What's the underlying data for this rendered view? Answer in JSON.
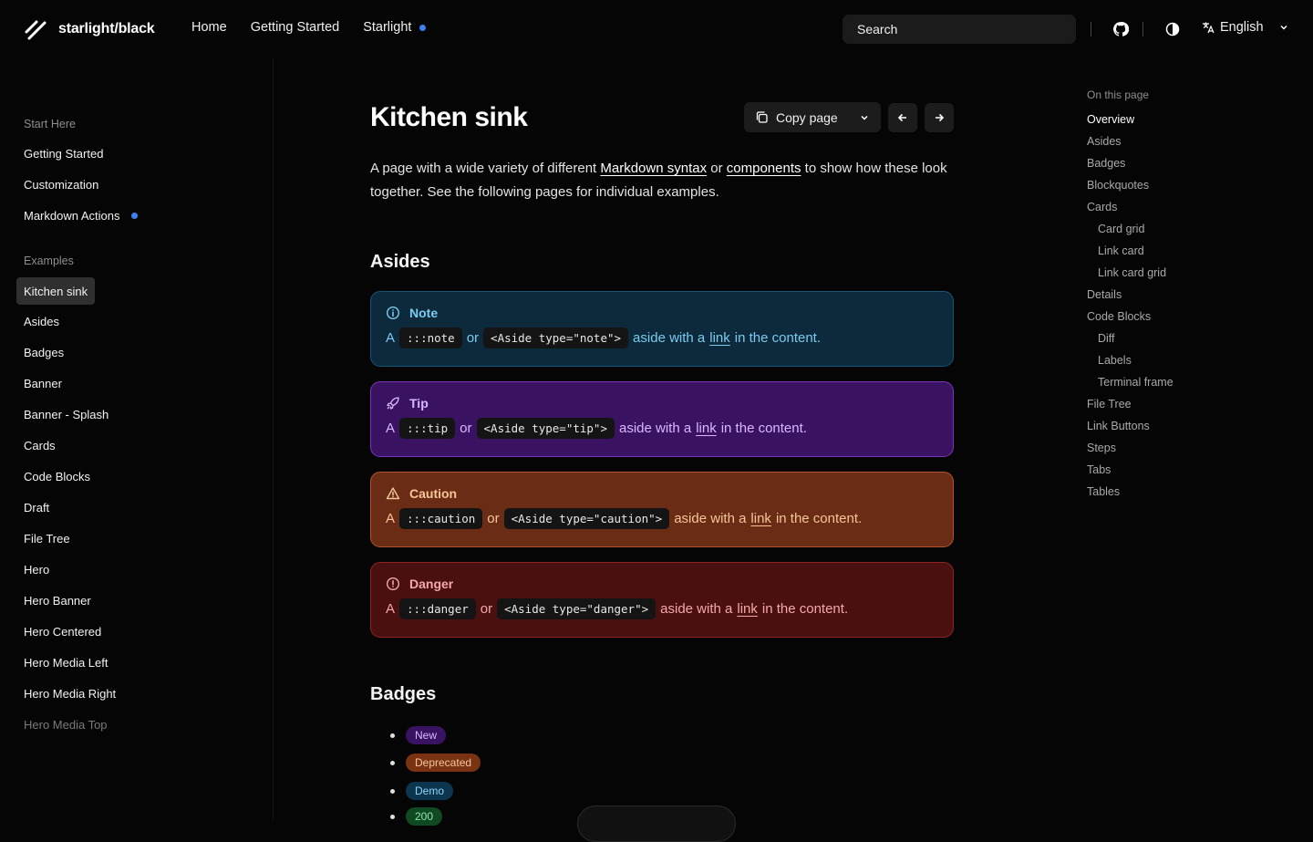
{
  "header": {
    "site_name": "starlight/black",
    "nav": [
      {
        "label": "Home"
      },
      {
        "label": "Getting Started"
      },
      {
        "label": "Starlight"
      }
    ],
    "search_label": "Search",
    "language": "English"
  },
  "sidebar": {
    "groups": [
      {
        "title": "Start Here",
        "items": [
          "Getting Started",
          "Customization",
          "Markdown Actions"
        ]
      },
      {
        "title": "Examples",
        "items": [
          "Kitchen sink",
          "Asides",
          "Badges",
          "Banner",
          "Banner - Splash",
          "Cards",
          "Code Blocks",
          "Draft",
          "File Tree",
          "Hero",
          "Hero Banner",
          "Hero Centered",
          "Hero Media Left",
          "Hero Media Right",
          "Hero Media Top"
        ]
      }
    ],
    "active": "Kitchen sink"
  },
  "page": {
    "title": "Kitchen sink",
    "copy_label": "Copy page",
    "intro_a": "A page with a wide variety of different ",
    "intro_link1": "Markdown syntax",
    "intro_b": " or ",
    "intro_link2": "components",
    "intro_c": " to show how these look together. See the following pages for individual examples.",
    "asides_heading": "Asides",
    "badges_heading": "Badges"
  },
  "asides": [
    {
      "kind": "note",
      "title": "Note",
      "code1": ":::note",
      "code2": "<Aside type=\"note\">"
    },
    {
      "kind": "tip",
      "title": "Tip",
      "code1": ":::tip",
      "code2": "<Aside type=\"tip\">"
    },
    {
      "kind": "caution",
      "title": "Caution",
      "code1": ":::caution",
      "code2": "<Aside type=\"caution\">"
    },
    {
      "kind": "danger",
      "title": "Danger",
      "code1": ":::danger",
      "code2": "<Aside type=\"danger\">"
    }
  ],
  "aside_text": {
    "a": "A",
    "or": "or",
    "mid": "aside with a",
    "link": "link",
    "end": "in the content."
  },
  "badges": [
    {
      "label": "New",
      "bg": "#3a1262",
      "fg": "#d9b8ff"
    },
    {
      "label": "Deprecated",
      "bg": "#7a3312",
      "fg": "#f6c59a"
    },
    {
      "label": "Demo",
      "bg": "#0c3550",
      "fg": "#8fd3f5"
    },
    {
      "label": "200",
      "bg": "#0f4a22",
      "fg": "#8fe3a8"
    }
  ],
  "toc": {
    "title": "On this page",
    "items": [
      {
        "label": "Overview",
        "level": 1
      },
      {
        "label": "Asides",
        "level": 1
      },
      {
        "label": "Badges",
        "level": 1
      },
      {
        "label": "Blockquotes",
        "level": 1
      },
      {
        "label": "Cards",
        "level": 1
      },
      {
        "label": "Card grid",
        "level": 2
      },
      {
        "label": "Link card",
        "level": 2
      },
      {
        "label": "Link card grid",
        "level": 2
      },
      {
        "label": "Details",
        "level": 1
      },
      {
        "label": "Code Blocks",
        "level": 1
      },
      {
        "label": "Diff",
        "level": 2
      },
      {
        "label": "Labels",
        "level": 2
      },
      {
        "label": "Terminal frame",
        "level": 2
      },
      {
        "label": "File Tree",
        "level": 1
      },
      {
        "label": "Link Buttons",
        "level": 1
      },
      {
        "label": "Steps",
        "level": 1
      },
      {
        "label": "Tabs",
        "level": 1
      },
      {
        "label": "Tables",
        "level": 1
      }
    ]
  },
  "colors": {
    "accent": "#3b82f6",
    "background": "#050505"
  }
}
